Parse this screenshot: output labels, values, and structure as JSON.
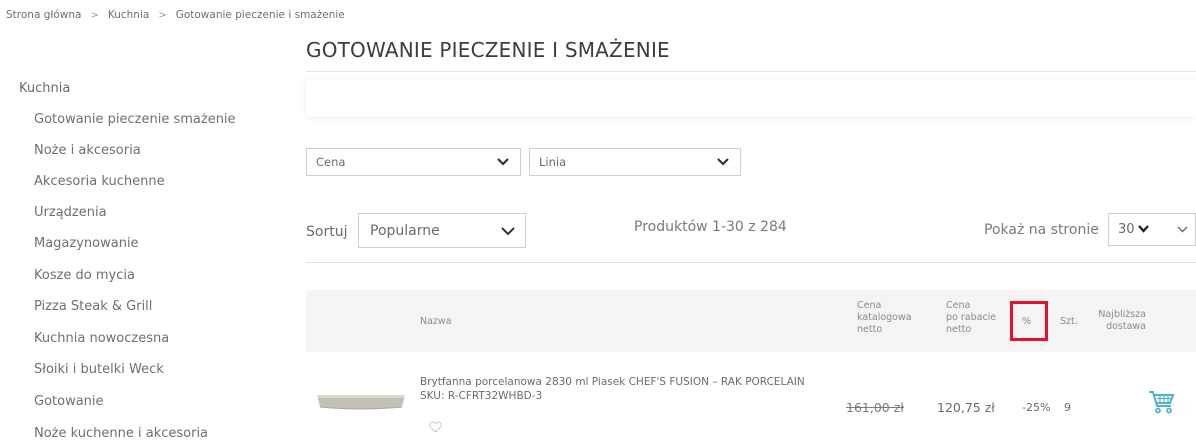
{
  "breadcrumb": [
    "Strona główna",
    "Kuchnia",
    "Gotowanie pieczenie i smażenie"
  ],
  "page_title": "GOTOWANIE PIECZENIE I SMAŻENIE",
  "sidebar": {
    "root": "Kuchnia",
    "items": [
      "Gotowanie pieczenie smażenie",
      "Noże i akcesoria",
      "Akcesoria kuchenne",
      "Urządzenia",
      "Magazynowanie",
      "Kosze do mycia",
      "Pizza Steak & Grill",
      "Kuchnia nowoczesna",
      "Słoiki i butelki Weck",
      "Gotowanie",
      "Noże kuchenne i akcesoria"
    ]
  },
  "filters": {
    "price": "Cena",
    "line": "Linia"
  },
  "toolbar": {
    "sort_label": "Sortuj",
    "sort_value": "Popularne",
    "product_count": "Produktów 1-30 z 284",
    "per_page_label": "Pokaż na stronie",
    "per_page_value": "30"
  },
  "table": {
    "headers": {
      "name": "Nazwa",
      "catalog_price": [
        "Cena",
        "katalogowa",
        "netto"
      ],
      "discount_price": [
        "Cena",
        "po rabacie",
        "netto"
      ],
      "discount": "%",
      "qty": "Szt.",
      "delivery": [
        "Najbliższa",
        "dostawa"
      ]
    },
    "rows": [
      {
        "name": "Brytfanna porcelanowa 2830 ml Piasek CHEF'S FUSION – RAK PORCELAIN",
        "sku": "SKU: R-CFRT32WHBD-3",
        "catalog_price": "161,00 zł",
        "discount_price": "120,75 zł",
        "discount": "-25%",
        "qty": "9"
      }
    ]
  },
  "colors": {
    "highlight": "#e5122b",
    "cart_icon": "#4fb3c9"
  },
  "icons": [
    "chevron-right-icon",
    "chevron-down-icon",
    "heart-outline-icon",
    "cart-icon"
  ]
}
